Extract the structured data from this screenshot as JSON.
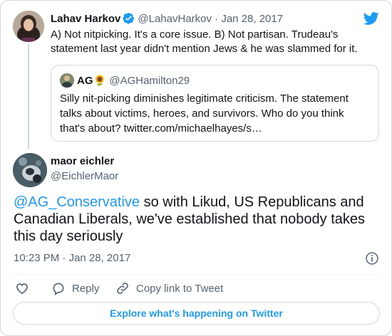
{
  "colors": {
    "accent": "#1d9bf0",
    "muted": "#536471",
    "border": "#cfd9de",
    "text": "#0f1419"
  },
  "reply_tweet": {
    "author_name": "Lahav Harkov",
    "handle": "@LahavHarkov",
    "separator": " · ",
    "date": "Jan 28, 2017",
    "text_line1": "A) Not nitpicking. It's a core issue. B) Not partisan. Trudeau's",
    "text_line2": "statement last year didn't mention Jews & he was slammed for it."
  },
  "quoted_tweet": {
    "author_name": "AG",
    "emoji": "🌻",
    "handle": "@AGHamilton29",
    "text_line1": "Silly nit-picking diminishes legitimate criticism. The statement",
    "text_line2": "talks about victims, heroes, and survivors. Who do you think",
    "text_line3": "that's about? twitter.com/michaelhayes/s…"
  },
  "main_tweet": {
    "author_name": "maor eichler",
    "handle": "@EichlerMaor",
    "mention": "@AG_Conservative",
    "text_part1": " so with Likud, US Republicans and",
    "text_line2": "Canadian Liberals, we've established that nobody takes",
    "text_line3": "this day seriously",
    "time": "10:23 PM",
    "meta_separator": " · ",
    "date": "Jan 28, 2017"
  },
  "actions": {
    "reply_label": "Reply",
    "copy_link_label": "Copy link to Tweet"
  },
  "explore_button": "Explore what's happening on Twitter",
  "icons": [
    "twitter-bird-icon",
    "verified-badge-icon",
    "info-icon",
    "heart-icon",
    "reply-icon",
    "link-icon"
  ]
}
